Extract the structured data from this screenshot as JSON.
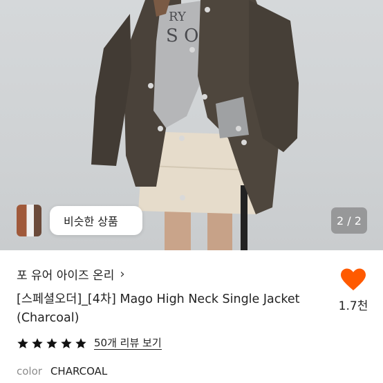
{
  "gallery": {
    "similar_label": "비슷한 상품",
    "page_indicator": "2 / 2"
  },
  "product": {
    "shop_name": "포 유어 아이즈 온리",
    "title": "[스페셜오더]_[4차] Mago High Neck Single Jacket (Charcoal)",
    "like_count": "1.7천",
    "rating_stars": 5,
    "review_link": "50개 리뷰 보기",
    "option_key": "color",
    "option_value": "CHARCOAL"
  },
  "colors": {
    "heart": "#ff5a00",
    "star": "#111111",
    "jacket": "#4a423a",
    "skirt": "#e6dccb"
  }
}
